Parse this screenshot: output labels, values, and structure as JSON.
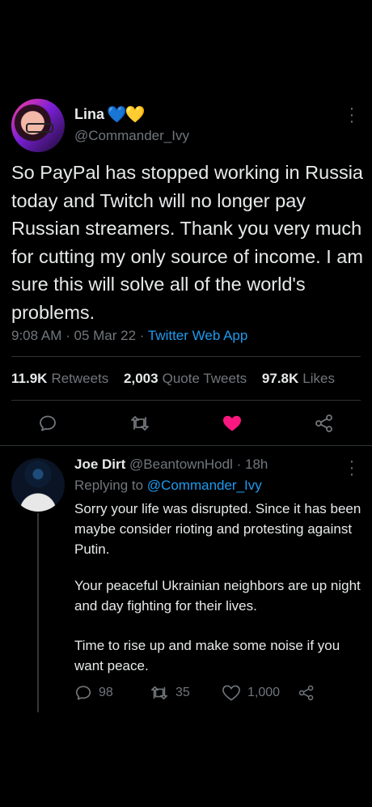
{
  "main_tweet": {
    "author_name": "Lina",
    "name_emoji": [
      "💙",
      "💛"
    ],
    "handle": "@Commander_Ivy",
    "text": "So PayPal has stopped working in Russia today and Twitch will no longer pay Russian streamers. Thank you very much for cutting my only source of income. I am sure this will solve all of the world's problems.",
    "time": "9:08 AM",
    "date": "05 Mar 22",
    "source": "Twitter Web App",
    "stats": {
      "retweets_count": "11.9K",
      "retweets_label": "Retweets",
      "quotes_count": "2,003",
      "quotes_label": "Quote Tweets",
      "likes_count": "97.8K",
      "likes_label": "Likes"
    },
    "actions": {
      "icons": [
        "reply-icon",
        "retweet-icon",
        "like-icon",
        "share-icon"
      ],
      "liked": true,
      "like_color": "#f91880"
    }
  },
  "reply": {
    "author_name": "Joe Dirt",
    "handle": "@BeantownHodl",
    "age": "18h",
    "replying_prefix": "Replying to",
    "replying_handle": "@Commander_Ivy",
    "paragraphs": [
      "Sorry your life was disrupted.  Since it has been maybe consider rioting and protesting against Putin.",
      "Your peaceful Ukrainian neighbors are up night and day fighting for their lives.",
      "Time to rise up and make some noise if you want peace."
    ],
    "counts": {
      "replies": "98",
      "retweets": "35",
      "likes": "1,000"
    }
  },
  "colors": {
    "background": "#000000",
    "text": "#e7e9ea",
    "muted": "#71767b",
    "accent": "#1d9bf0",
    "divider": "#2f3336"
  }
}
